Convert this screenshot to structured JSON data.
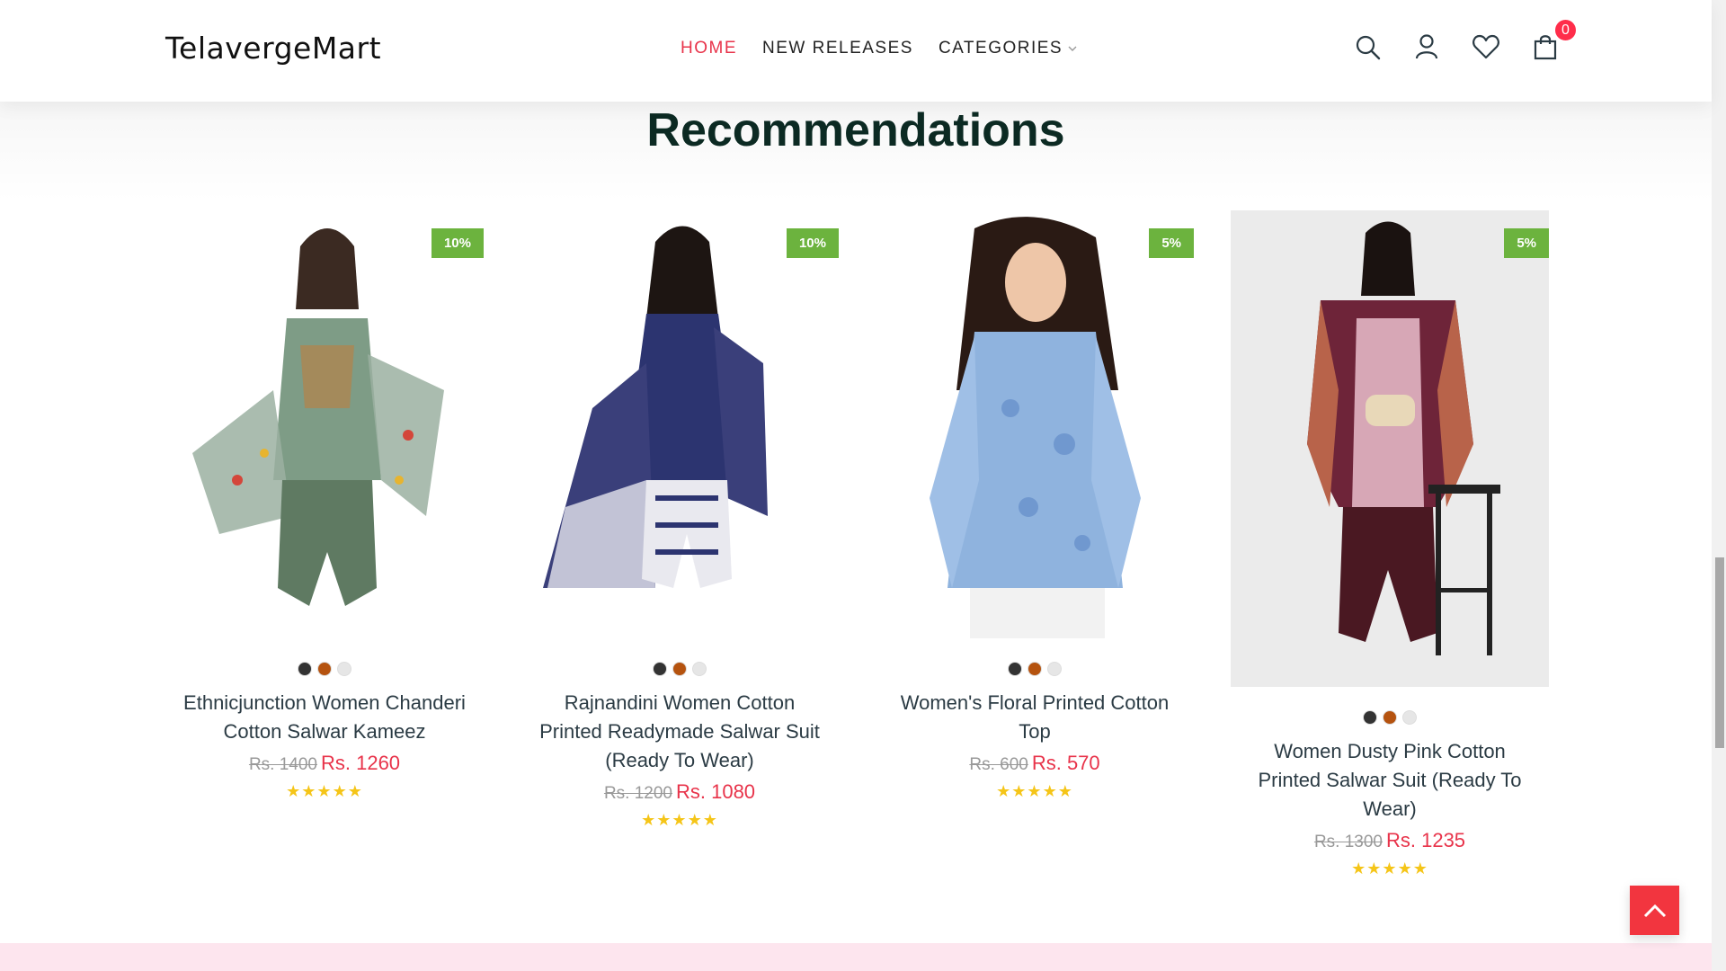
{
  "brand": {
    "logo_text": "TelavergeMart"
  },
  "nav": {
    "items": [
      {
        "label": "HOME",
        "active": true
      },
      {
        "label": "NEW RELEASES",
        "active": false
      },
      {
        "label": "CATEGORIES",
        "active": false
      }
    ]
  },
  "header_icons": [
    "search-icon",
    "user-icon",
    "heart-icon",
    "shopping-bag-icon"
  ],
  "cart": {
    "count": "0"
  },
  "section": {
    "title": "Recommendations"
  },
  "products": [
    {
      "name": "Ethnicjunction Women Chanderi Cotton Salwar Kameez",
      "discount": "10%",
      "old_price": "Rs. 1400",
      "new_price": "Rs. 1260",
      "rating": 5,
      "swatches": [
        "#333333",
        "#b5530f",
        "#e6e6e6"
      ]
    },
    {
      "name": "Rajnandini Women Cotton Printed Readymade Salwar Suit (Ready To Wear)",
      "discount": "10%",
      "old_price": "Rs. 1200",
      "new_price": "Rs. 1080",
      "rating": 5,
      "swatches": [
        "#333333",
        "#b5530f",
        "#e6e6e6"
      ]
    },
    {
      "name": "Women's Floral Printed Cotton Top",
      "discount": "5%",
      "old_price": "Rs. 600",
      "new_price": "Rs. 570",
      "rating": 5,
      "swatches": [
        "#333333",
        "#b5530f",
        "#e6e6e6"
      ]
    },
    {
      "name": "Women Dusty Pink Cotton Printed Salwar Suit (Ready To Wear)",
      "discount": "5%",
      "old_price": "Rs. 1300",
      "new_price": "Rs. 1235",
      "rating": 5,
      "swatches": [
        "#333333",
        "#b5530f",
        "#e6e6e6"
      ]
    }
  ],
  "colors": {
    "accent": "#e8334a",
    "discount_badge": "#6cb33e",
    "title": "#0c2a23",
    "star": "#f5c518",
    "scroll_top_button": "#f2353f"
  }
}
